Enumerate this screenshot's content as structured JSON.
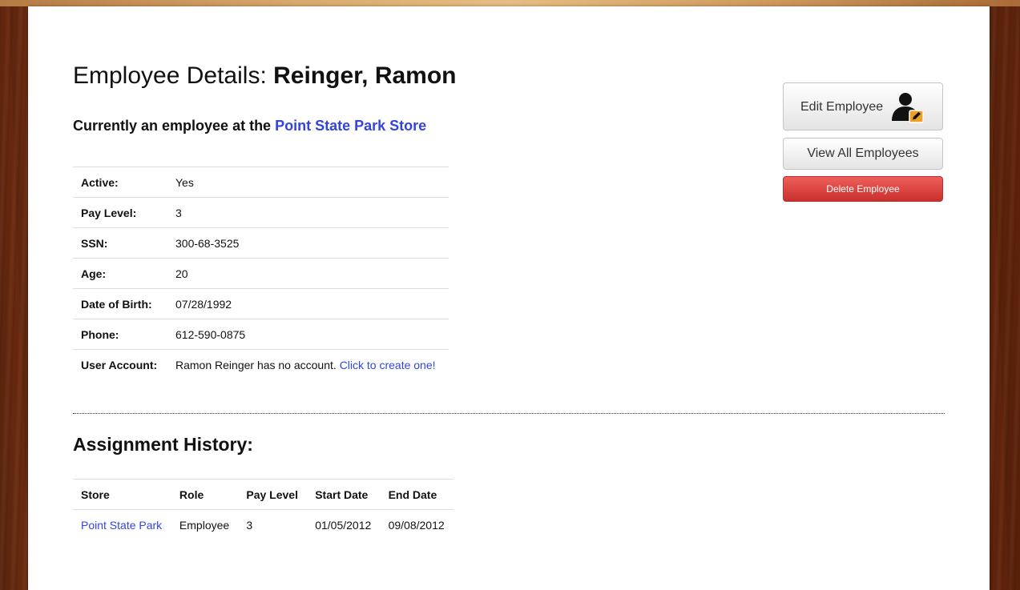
{
  "page": {
    "title_prefix": "Employee Details:",
    "employee_name": "Reinger, Ramon",
    "subtitle_prefix": "Currently an employee at the",
    "subtitle_store_link": "Point State Park Store"
  },
  "details": [
    {
      "label": "Active:",
      "value": "Yes"
    },
    {
      "label": "Pay Level:",
      "value": "3"
    },
    {
      "label": "SSN:",
      "value": "300-68-3525"
    },
    {
      "label": "Age:",
      "value": "20"
    },
    {
      "label": "Date of Birth:",
      "value": "07/28/1992"
    },
    {
      "label": "Phone:",
      "value": "612-590-0875"
    },
    {
      "label": "User Account:",
      "value": "Ramon Reinger has no account.",
      "link_text": "Click to create one!"
    }
  ],
  "actions": {
    "edit_label": "Edit Employee",
    "edit_icon": "edit-user-icon",
    "view_all_label": "View All Employees",
    "delete_label": "Delete Employee"
  },
  "history": {
    "title": "Assignment History:",
    "columns": [
      "Store",
      "Role",
      "Pay Level",
      "Start Date",
      "End Date"
    ],
    "rows": [
      {
        "store": "Point State Park",
        "role": "Employee",
        "pay_level": "3",
        "start_date": "01/05/2012",
        "end_date": "09/08/2012"
      }
    ]
  },
  "colors": {
    "link": "#3344dd",
    "delete_button": "#da4f49",
    "edit_icon_badge": "#f0a020",
    "background_wood": "#a34a20"
  }
}
